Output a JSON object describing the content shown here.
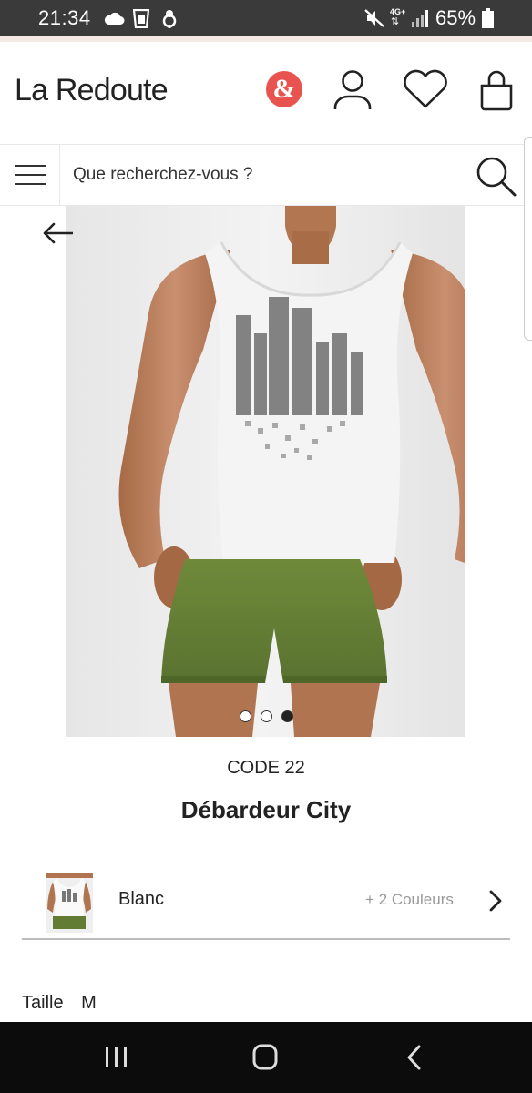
{
  "status_bar": {
    "time": "21:34",
    "network": "4G+",
    "battery": "65%",
    "icons": [
      "cloud-icon",
      "cup-icon",
      "tree-icon",
      "mute-icon",
      "network-icon",
      "signal-icon",
      "battery-icon"
    ]
  },
  "header": {
    "logo": "La Redoute",
    "ampersand": "&",
    "accent_color": "#e8534f",
    "icons": [
      "ampersand-icon",
      "account-icon",
      "wishlist-icon",
      "basket-icon"
    ]
  },
  "search": {
    "placeholder": "Que recherchez-vous ?"
  },
  "gallery": {
    "dot_count": 3,
    "active_dot": 3
  },
  "product": {
    "brand": "CODE 22",
    "title": "Débardeur City"
  },
  "color_selector": {
    "selected": "Blanc",
    "more": "+ 2 Couleurs"
  },
  "size": {
    "label": "Taille",
    "value": "M"
  },
  "nav": {
    "icons": [
      "recents-icon",
      "home-icon",
      "back-icon"
    ]
  }
}
